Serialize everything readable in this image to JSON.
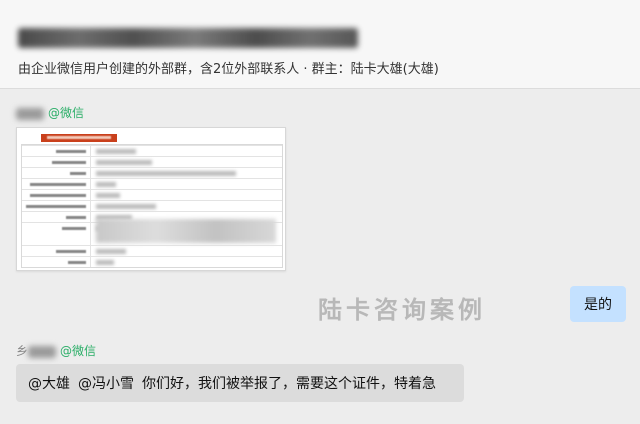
{
  "header": {
    "subtitle": "由企业微信用户创建的外部群，含2位外部联系人 · 群主：陆卡大雄(大雄)"
  },
  "messages": [
    {
      "sender_suffix": "@微信"
    },
    {
      "text": "是的"
    },
    {
      "sender_prefix": "乡",
      "sender_suffix": "@微信",
      "mention1": "@大雄",
      "mention2": "@冯小雪",
      "text": "你们好，我们被举报了，需要这个证件，特着急"
    }
  ],
  "watermark": "陆卡咨询案例",
  "colors": {
    "background": "#ededed",
    "self_bubble": "#c4e1ff",
    "other_bubble": "#dcdcdc",
    "wechat_tag": "#2aae67",
    "doc_header": "#c9401c"
  }
}
